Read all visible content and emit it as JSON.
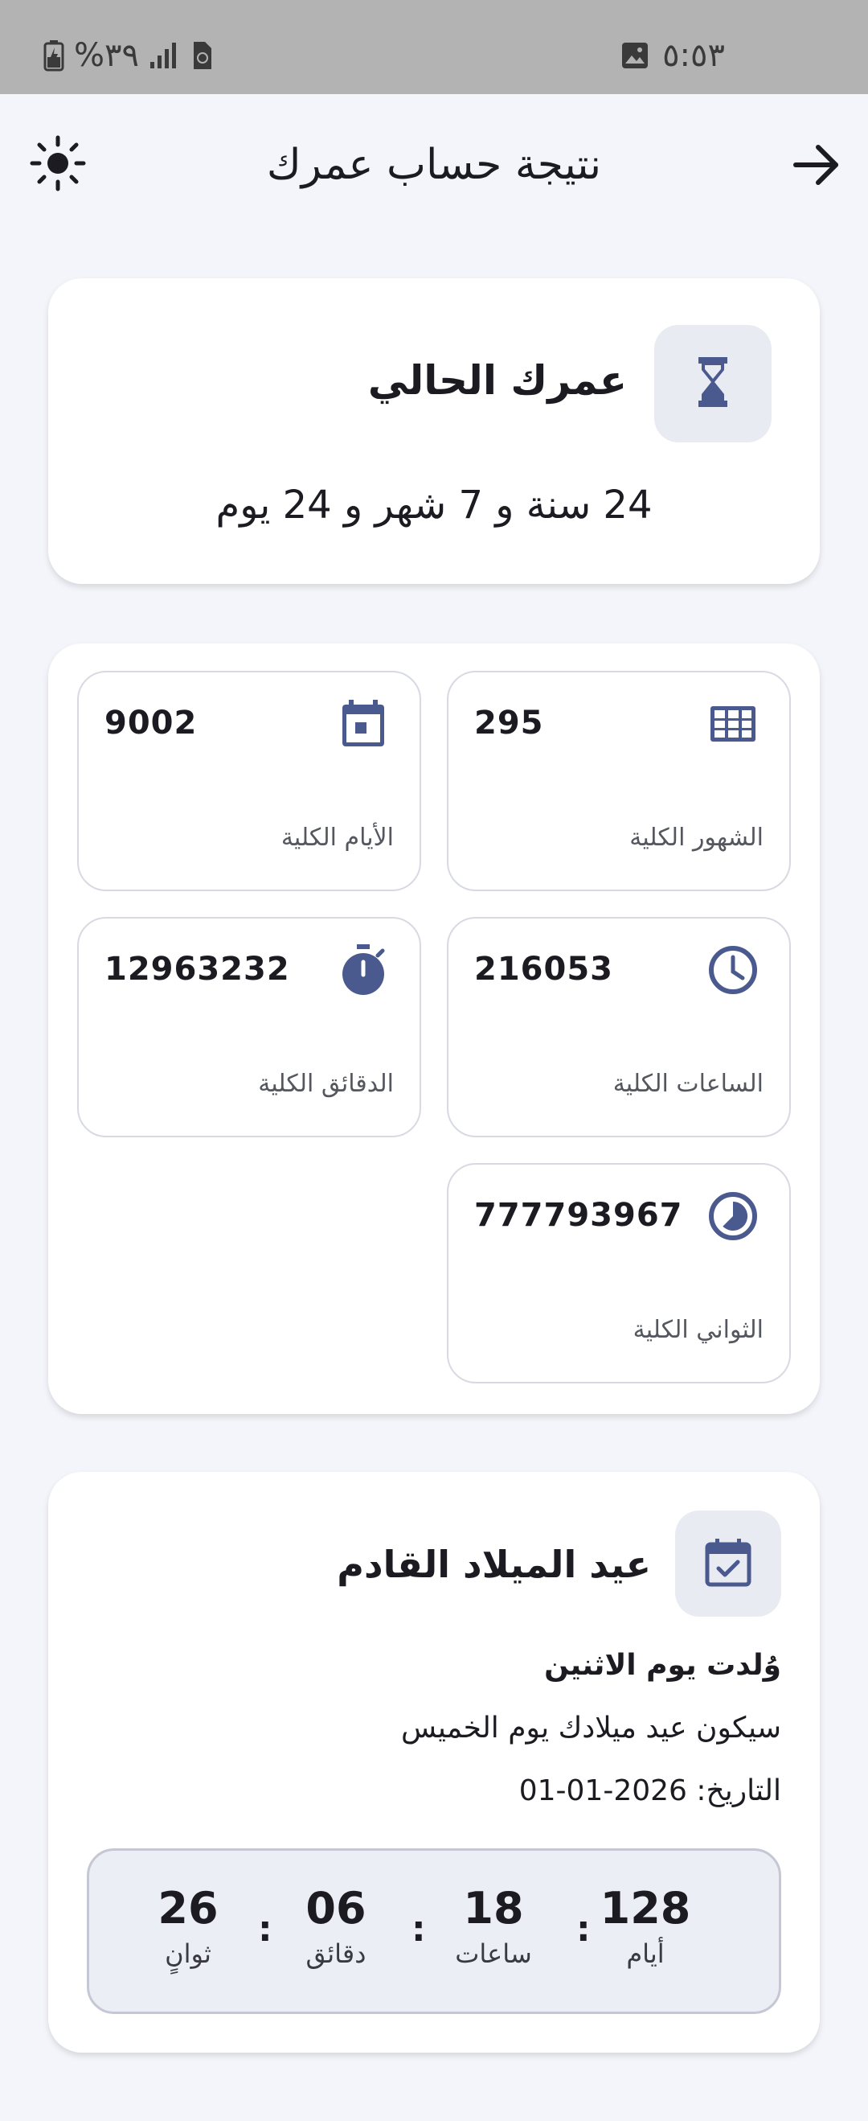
{
  "status_bar": {
    "battery_percent": "%٣٩",
    "time": "٥:٥٣",
    "icons": [
      "battery-icon",
      "signal-icon",
      "sim-icon",
      "gallery-icon"
    ]
  },
  "app_bar": {
    "title": "نتيجة حساب عمرك",
    "icons": [
      "sun-icon",
      "back-arrow-icon"
    ]
  },
  "current_age": {
    "heading": "عمرك الحالي",
    "value": "24 سنة و 7 شهر و 24 يوم",
    "icon": "hourglass-icon"
  },
  "stats": [
    {
      "label": "الشهور الكلية",
      "value": "295",
      "icon": "grid-icon"
    },
    {
      "label": "الأيام الكلية",
      "value": "9002",
      "icon": "calendar-icon"
    },
    {
      "label": "الساعات الكلية",
      "value": "216053",
      "icon": "clock-icon"
    },
    {
      "label": "الدقائق الكلية",
      "value": "12963232",
      "icon": "stopwatch-icon"
    },
    {
      "label": "الثواني الكلية",
      "value": "777793967",
      "icon": "timelapse-icon"
    }
  ],
  "next_birthday": {
    "heading": "عيد الميلاد القادم",
    "born_day": "وُلدت يوم الاثنين",
    "birthday_day": "سيكون عيد ميلادك يوم الخميس",
    "date_label": "التاريخ: 2026-01-01",
    "icon": "calendar-check-icon",
    "countdown": {
      "days": {
        "value": "128",
        "label": "أيام"
      },
      "hours": {
        "value": "18",
        "label": "ساعات"
      },
      "minutes": {
        "value": "06",
        "label": "دقائق"
      },
      "seconds": {
        "value": "26",
        "label": "ثوانٍ"
      },
      "separator": ":"
    }
  },
  "colors": {
    "accent": "#4a5a8f",
    "background": "#f4f5fa",
    "card": "#ffffff",
    "tile": "#e9ebf2"
  }
}
